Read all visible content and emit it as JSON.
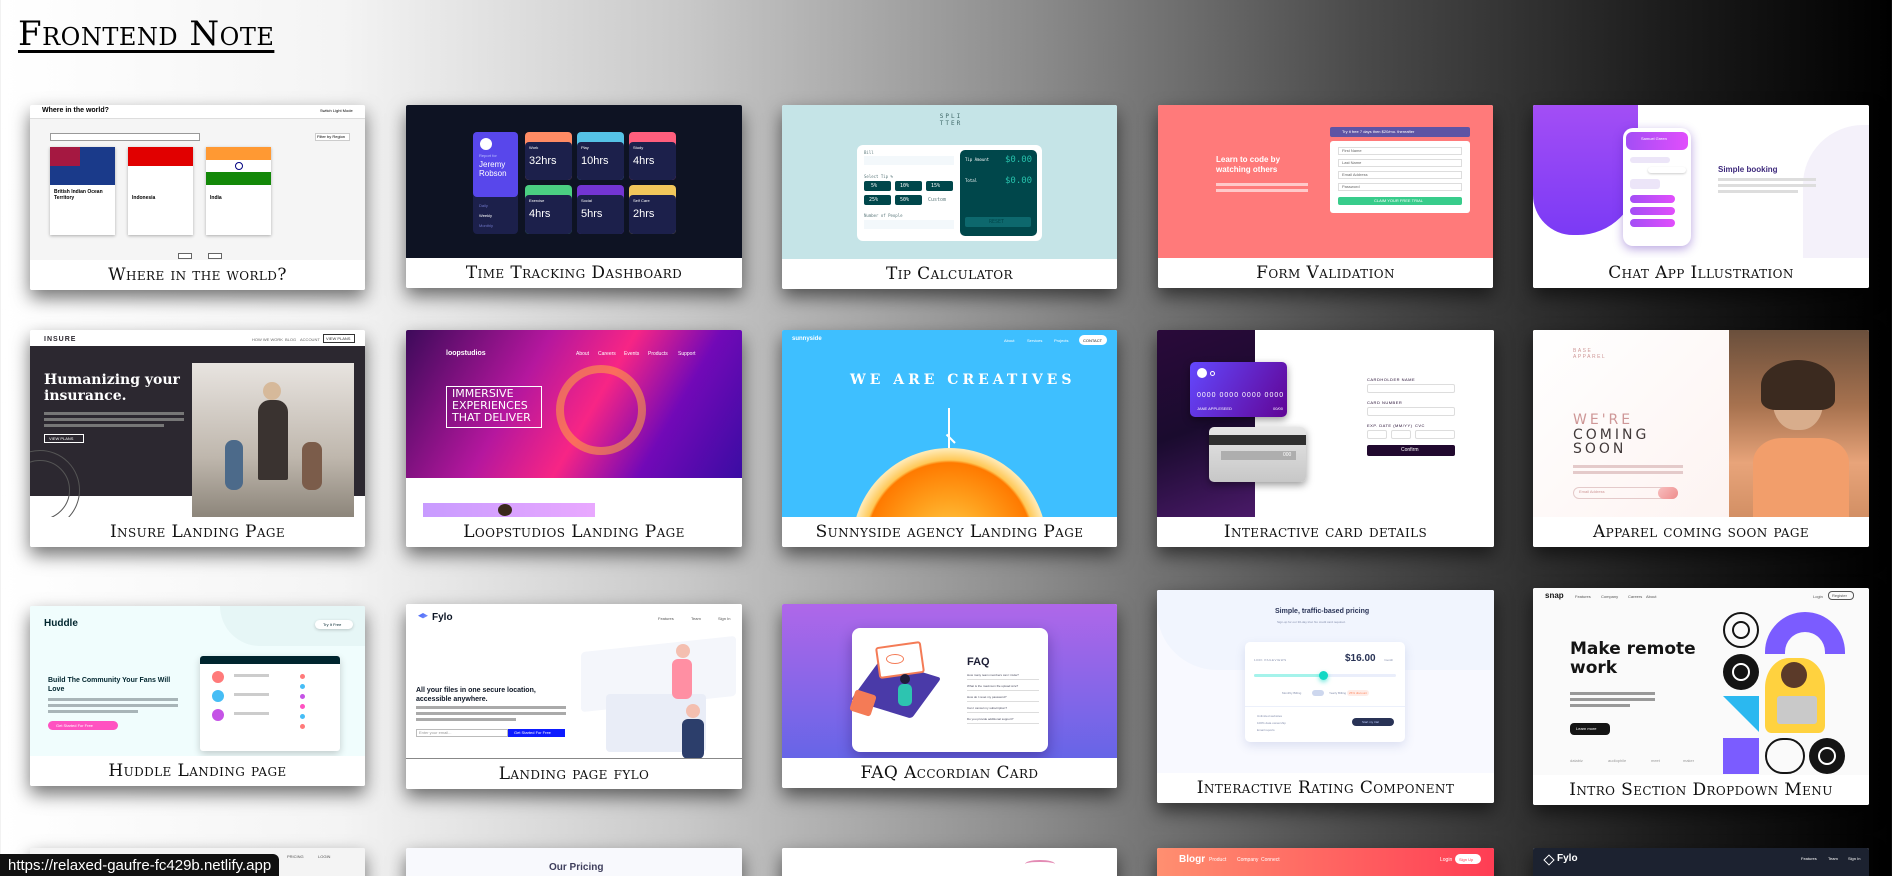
{
  "page": {
    "title": "Frontend Note"
  },
  "cards": [
    {
      "caption": "Where in the world?",
      "preview": {
        "header": "Where in the world?",
        "mode": "Switch Light Mode",
        "filter": "Filter by Region",
        "countries": [
          "British Indian Ocean Territory",
          "Indonesia",
          "India"
        ],
        "prev": "Prev",
        "next": "Next"
      }
    },
    {
      "caption": "Time Tracking Dashboard",
      "preview": {
        "report_for": "Report for",
        "name": "Jeremy Robson",
        "periods": [
          "Daily",
          "Weekly",
          "Monthly"
        ],
        "tiles": [
          {
            "label": "Work",
            "value": "32hrs"
          },
          {
            "label": "Play",
            "value": "10hrs"
          },
          {
            "label": "Study",
            "value": "4hrs"
          },
          {
            "label": "Exercise",
            "value": "4hrs"
          },
          {
            "label": "Social",
            "value": "5hrs"
          },
          {
            "label": "Self Care",
            "value": "2hrs"
          }
        ]
      }
    },
    {
      "caption": "Tip Calculator",
      "preview": {
        "logo": "SPLI TTER",
        "bill": "Bill",
        "select_tip": "Select Tip %",
        "tips": [
          "5%",
          "10%",
          "15%",
          "25%",
          "50%",
          "Custom"
        ],
        "people": "Number of People",
        "tip_amount": "Tip Amount",
        "total": "Total",
        "amount": "$0.00",
        "reset": "RESET"
      }
    },
    {
      "caption": "Form Validation",
      "preview": {
        "headline": "Learn to code by watching others",
        "trial": "Try it free 7 days then $20/mo. thereafter",
        "fields": [
          "First Name",
          "Last Name",
          "Email Address",
          "Password"
        ],
        "cta": "CLAIM YOUR FREE TRIAL"
      }
    },
    {
      "caption": "Chat App Illustration",
      "preview": {
        "contact": "Samuel Green",
        "title": "Simple booking"
      }
    },
    {
      "caption": "Insure Landing Page",
      "preview": {
        "logo": "INSURE",
        "nav": [
          "HOW WE WORK",
          "BLOG",
          "ACCOUNT",
          "VIEW PLANS"
        ],
        "headline": "Humanizing your insurance.",
        "cta": "VIEW PLANS"
      }
    },
    {
      "caption": "Loopstudios Landing Page",
      "preview": {
        "logo": "loopstudios",
        "nav": [
          "About",
          "Careers",
          "Events",
          "Products",
          "Support"
        ],
        "headline": "IMMERSIVE EXPERIENCES THAT DELIVER"
      }
    },
    {
      "caption": "Sunnyside agency Landing Page",
      "preview": {
        "logo": "sunnyside",
        "nav": [
          "About",
          "Services",
          "Projects",
          "CONTACT"
        ],
        "headline": "WE ARE CREATIVES"
      }
    },
    {
      "caption": "Interactive card details",
      "preview": {
        "card_number": "0000 0000 0000 0000",
        "card_name": "JANE APPLESEED",
        "card_exp": "00/00",
        "cvc": "000",
        "labels": [
          "CARDHOLDER NAME",
          "CARD NUMBER",
          "EXP. DATE (MM/YY)",
          "CVC"
        ],
        "confirm": "Confirm"
      }
    },
    {
      "caption": "Apparel coming soon page",
      "preview": {
        "logo": "BASE APPAREL",
        "headline_a": "WE'RE",
        "headline_b": "COMING SOON",
        "email": "Email Address"
      }
    },
    {
      "caption": "Huddle Landing page",
      "preview": {
        "logo": "Huddle",
        "nav": "Try It Free",
        "headline": "Build The Community Your Fans Will Love",
        "cta": "Get Started For Free"
      }
    },
    {
      "caption": "Landing page fylo",
      "preview": {
        "logo": "Fylo",
        "nav": [
          "Features",
          "Team",
          "Sign In"
        ],
        "headline": "All your files in one secure location, accessible anywhere.",
        "email": "Enter your email...",
        "cta": "Get Started For Free"
      }
    },
    {
      "caption": "FAQ Accordian Card",
      "preview": {
        "title": "FAQ",
        "questions": [
          "How many team members can I invite?",
          "What is the maximum file upload size?",
          "How do I reset my password?",
          "Can I cancel my subscription?",
          "Do you provide additional support?"
        ]
      }
    },
    {
      "caption": "Interactive Rating Component",
      "preview": {
        "title": "Simple, traffic-based pricing",
        "sub": "Sign-up for our 30-day trial. No credit card required.",
        "views": "100K PAGEVIEWS",
        "price": "$16.00",
        "per": "/month",
        "billing": [
          "Monthly Billing",
          "Yearly Billing",
          "25% discount"
        ],
        "features": [
          "Unlimited websites",
          "100% data ownership",
          "Email reports"
        ],
        "cta": "Start my trial"
      }
    },
    {
      "caption": "Intro Section Dropdown Menu",
      "preview": {
        "logo": "snap",
        "nav": [
          "Features",
          "Company",
          "Careers",
          "About"
        ],
        "login": "Login",
        "register": "Register",
        "headline": "Make remote work",
        "cta": "Learn more",
        "clients": [
          "databiz",
          "audiophile",
          "meet",
          "maker"
        ]
      }
    },
    {
      "caption": "",
      "preview": {
        "nav": [
          "PRICING",
          "LOGIN"
        ]
      }
    },
    {
      "caption": "",
      "preview": {
        "title": "Our Pricing"
      }
    },
    {
      "caption": "",
      "preview": {}
    },
    {
      "caption": "",
      "preview": {
        "logo": "Blogr",
        "nav": [
          "Product",
          "Company",
          "Connect"
        ],
        "login": "Login",
        "signup": "Sign Up"
      }
    },
    {
      "caption": "",
      "preview": {
        "logo": "Fylo",
        "nav": [
          "Features",
          "Team",
          "Sign In"
        ]
      }
    }
  ],
  "status_bar": {
    "url": "https://relaxed-gaufre-fc429b.netlify.app"
  }
}
